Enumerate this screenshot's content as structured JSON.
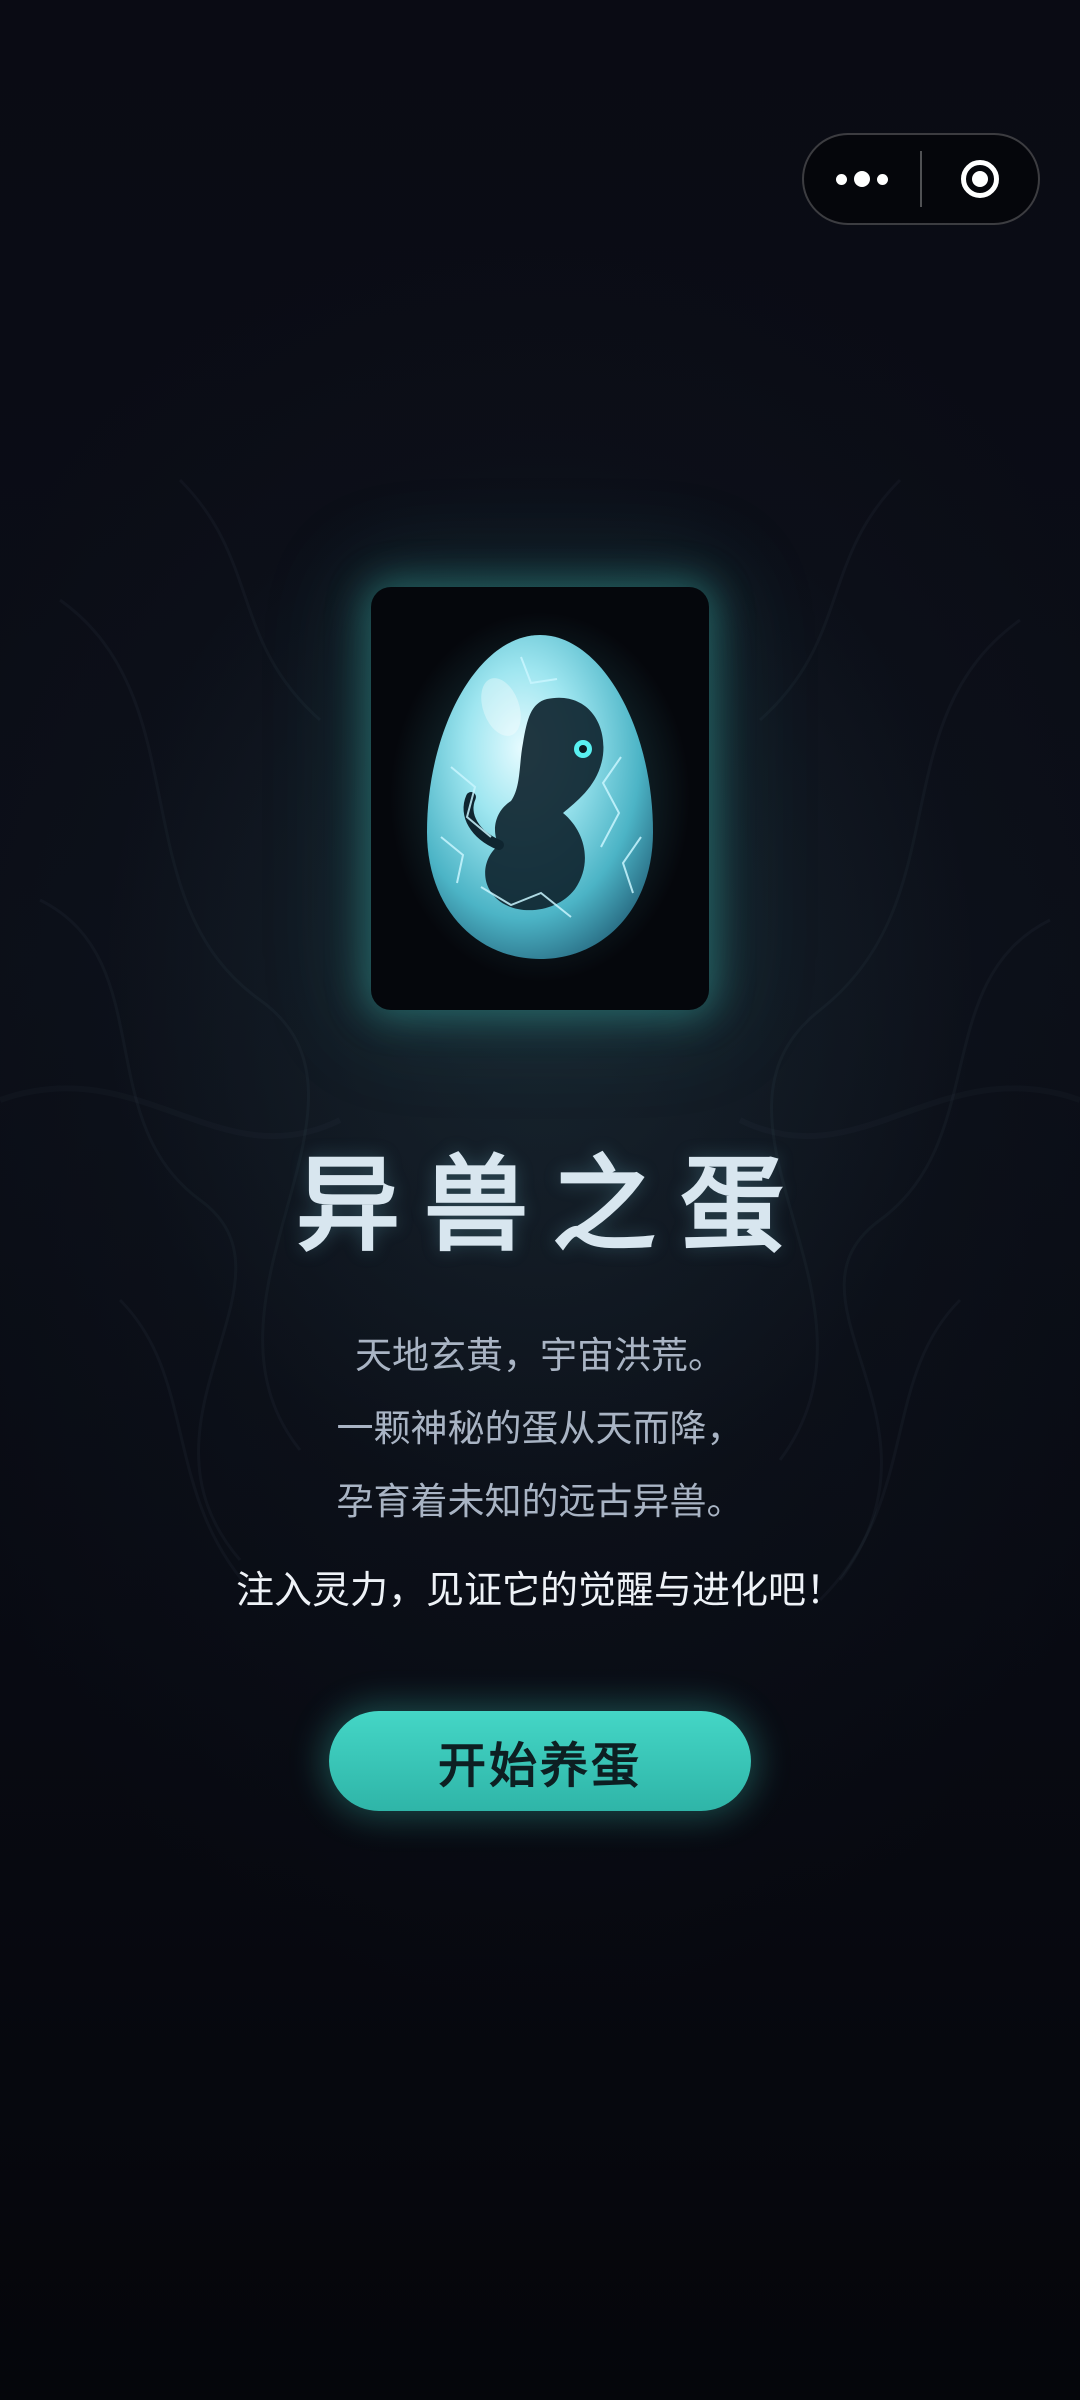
{
  "menu_capsule": {
    "more_icon": "more-dots-icon",
    "close_icon": "target-close-icon"
  },
  "hero": {
    "image_description": "glowing cyan egg with a dark creature curled inside",
    "glow_color": "#3fbfb4"
  },
  "title": "异兽之蛋",
  "intro_lines": [
    "天地玄黄，宇宙洪荒。",
    "一颗神秘的蛋从天而降，",
    "孕育着未知的远古异兽。"
  ],
  "callout": "注入灵力，见证它的觉醒与进化吧！",
  "start_button": {
    "label": "开始养蛋",
    "color": "#3cc8b9"
  }
}
